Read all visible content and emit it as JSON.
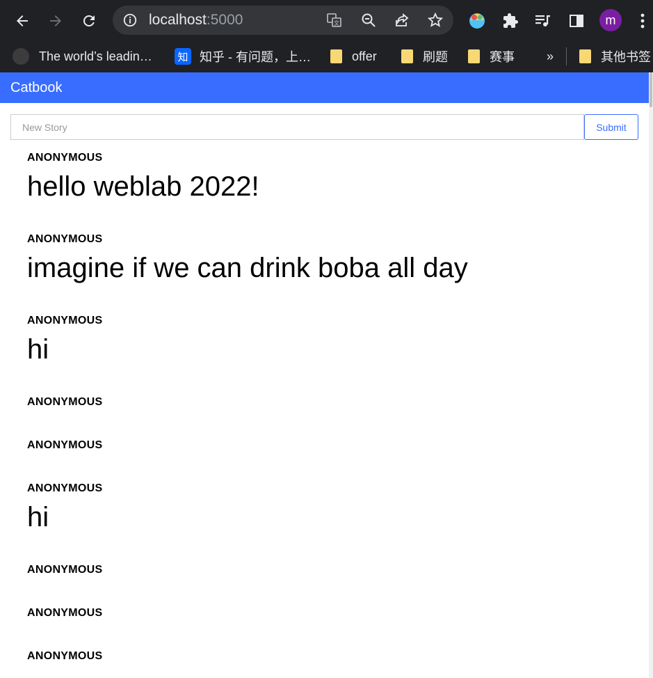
{
  "browser": {
    "url_host": "localhost",
    "url_port": ":5000",
    "profile_initial": "m",
    "bookmarks": [
      {
        "label": "The world’s leadin…",
        "icon": "github-icon"
      },
      {
        "label": "知乎 - 有问题，上…",
        "icon": "zhihu-icon",
        "icon_text": "知"
      },
      {
        "label": "offer",
        "icon": "folder-icon"
      },
      {
        "label": "刷题",
        "icon": "folder-icon"
      },
      {
        "label": "赛事",
        "icon": "folder-icon"
      },
      {
        "label": "»",
        "icon": "chevron-right-icon"
      },
      {
        "label": "其他书签",
        "icon": "folder-icon"
      }
    ]
  },
  "app": {
    "title": "Catbook",
    "new_story_placeholder": "New Story",
    "submit_label": "Submit"
  },
  "stories": [
    {
      "creator": "ANONYMOUS",
      "content": "hello weblab 2022!"
    },
    {
      "creator": "ANONYMOUS",
      "content": "imagine if we can drink boba all day"
    },
    {
      "creator": "ANONYMOUS",
      "content": "hi"
    },
    {
      "creator": "ANONYMOUS",
      "content": ""
    },
    {
      "creator": "ANONYMOUS",
      "content": ""
    },
    {
      "creator": "ANONYMOUS",
      "content": "hi"
    },
    {
      "creator": "ANONYMOUS",
      "content": ""
    },
    {
      "creator": "ANONYMOUS",
      "content": ""
    },
    {
      "creator": "ANONYMOUS",
      "content": ""
    }
  ],
  "colors": {
    "accent": "#396dff",
    "chrome_bg": "#202124",
    "omnibox_bg": "#35363a",
    "folder": "#f8d775",
    "avatar": "#7b1fa2"
  }
}
